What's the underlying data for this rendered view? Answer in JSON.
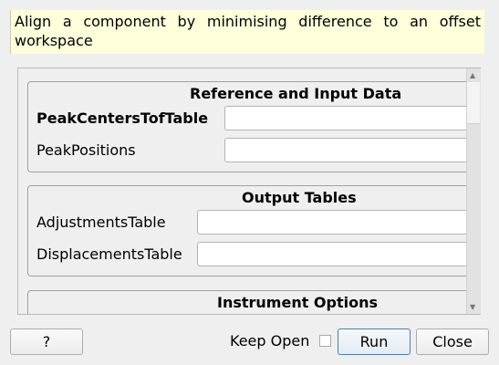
{
  "description": "Align a component by minimising difference to an offset workspace",
  "groups": [
    {
      "title": "Reference and Input Data",
      "fields": [
        {
          "label": "PeakCentersTofTable",
          "value": ""
        },
        {
          "label": "PeakPositions",
          "value": ""
        }
      ]
    },
    {
      "title": "Output Tables",
      "fields": [
        {
          "label": "AdjustmentsTable",
          "value": ""
        },
        {
          "label": "DisplacementsTable",
          "value": ""
        }
      ]
    },
    {
      "title": "Instrument Options"
    }
  ],
  "footer": {
    "help": "?",
    "keep_open": "Keep Open",
    "run": "Run",
    "close": "Close"
  }
}
